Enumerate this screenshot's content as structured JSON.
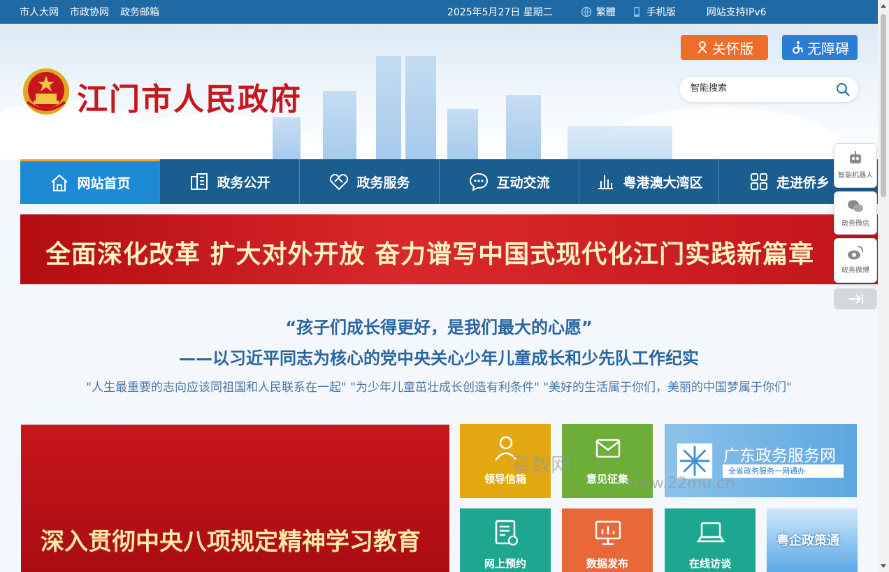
{
  "topbar": {
    "links": [
      "市人大网",
      "市政协网",
      "政务邮箱"
    ],
    "date": "2025年5月27日 星期二",
    "traditional": "繁體",
    "mobile": "手机版",
    "ipv6": "网站支持IPv6"
  },
  "header": {
    "site_title": "江门市人民政府",
    "care_label": "关怀版",
    "access_label": "无障碍",
    "search_placeholder": "智能搜索"
  },
  "nav": [
    {
      "label": "网站首页",
      "icon": "home-icon"
    },
    {
      "label": "政务公开",
      "icon": "building-icon"
    },
    {
      "label": "政务服务",
      "icon": "handshake-icon"
    },
    {
      "label": "互动交流",
      "icon": "chat-icon"
    },
    {
      "label": "粤港澳大湾区",
      "icon": "bar-chart-icon"
    },
    {
      "label": "走进侨乡",
      "icon": "grid-icon"
    }
  ],
  "banner": {
    "text": "全面深化改革 扩大对外开放 奋力谱写中国式现代化江门实践新篇章"
  },
  "headline": {
    "title": "“孩子们成长得更好，是我们最大的心愿”",
    "subtitle": "——以习近平同志为核心的党中央关心少年儿童成长和少先队工作纪实",
    "quotes": "\"人生最重要的志向应该同祖国和人民联系在一起\" \"为少年儿童茁壮成长创造有利条件\" \"美好的生活属于你们，美丽的中国梦属于你们\""
  },
  "feature": {
    "text": "深入贯彻中央八项规定精神学习教育"
  },
  "tiles": [
    {
      "label": "领导信箱",
      "color": "#e3a811"
    },
    {
      "label": "意见征集",
      "color": "#6cae38"
    },
    {
      "label": "网上预约",
      "color": "#1fa690"
    },
    {
      "label": "数据发布",
      "color": "#e9683a"
    },
    {
      "label": "在线访谈",
      "color": "#1fa690"
    }
  ],
  "gd_service": {
    "title": "广东政务服务网",
    "sub": "全省政务服务一网通办"
  },
  "yq_policy": {
    "title": "粤企政策通"
  },
  "float": {
    "robot": "智能机器人",
    "wechat": "政务微信",
    "weibo": "政务微博"
  },
  "watermark": {
    "text": "慕数网",
    "url": "www.22mu.cn"
  }
}
